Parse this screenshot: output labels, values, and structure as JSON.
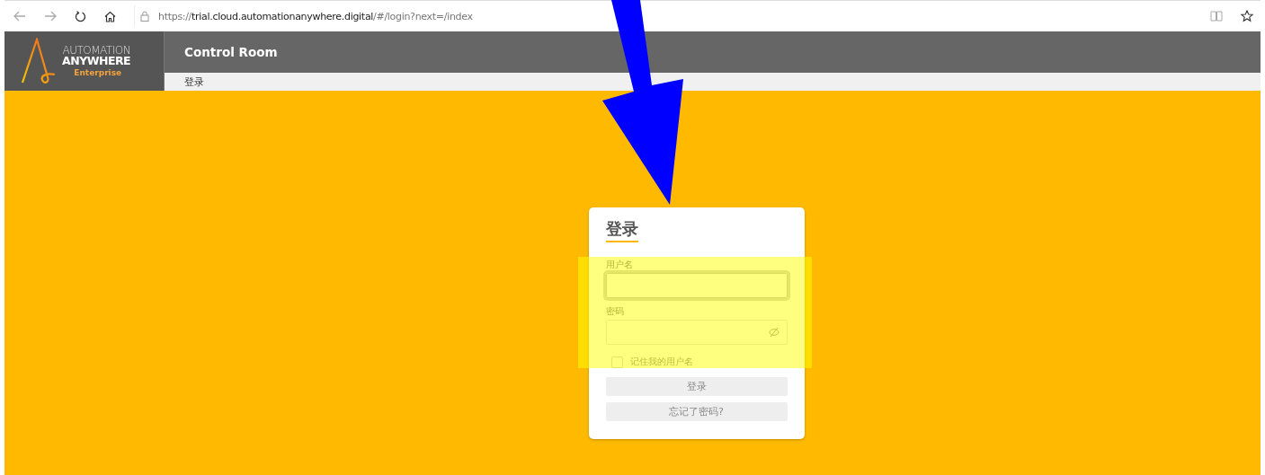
{
  "browser": {
    "url_scheme": "https://",
    "url_host": "trial.cloud.automationanywhere.digital",
    "url_path": "/#/login?next=/index"
  },
  "header": {
    "logo": {
      "line_1": "AUTOMATION",
      "line_2": "ANYWHERE",
      "edition": "Enterprise"
    },
    "title": "Control Room",
    "breadcrumb": "登录"
  },
  "login_card": {
    "title": "登录",
    "fields": [
      {
        "kind": "text",
        "label": "用户名",
        "focused": true
      },
      {
        "kind": "password",
        "label": "密码",
        "focused": false
      }
    ],
    "remember": {
      "label": "记住我的用户名",
      "checked": false
    },
    "buttons": [
      {
        "label": "登录",
        "disabled": true
      },
      {
        "label": "忘记了密码?",
        "disabled": true
      }
    ]
  }
}
